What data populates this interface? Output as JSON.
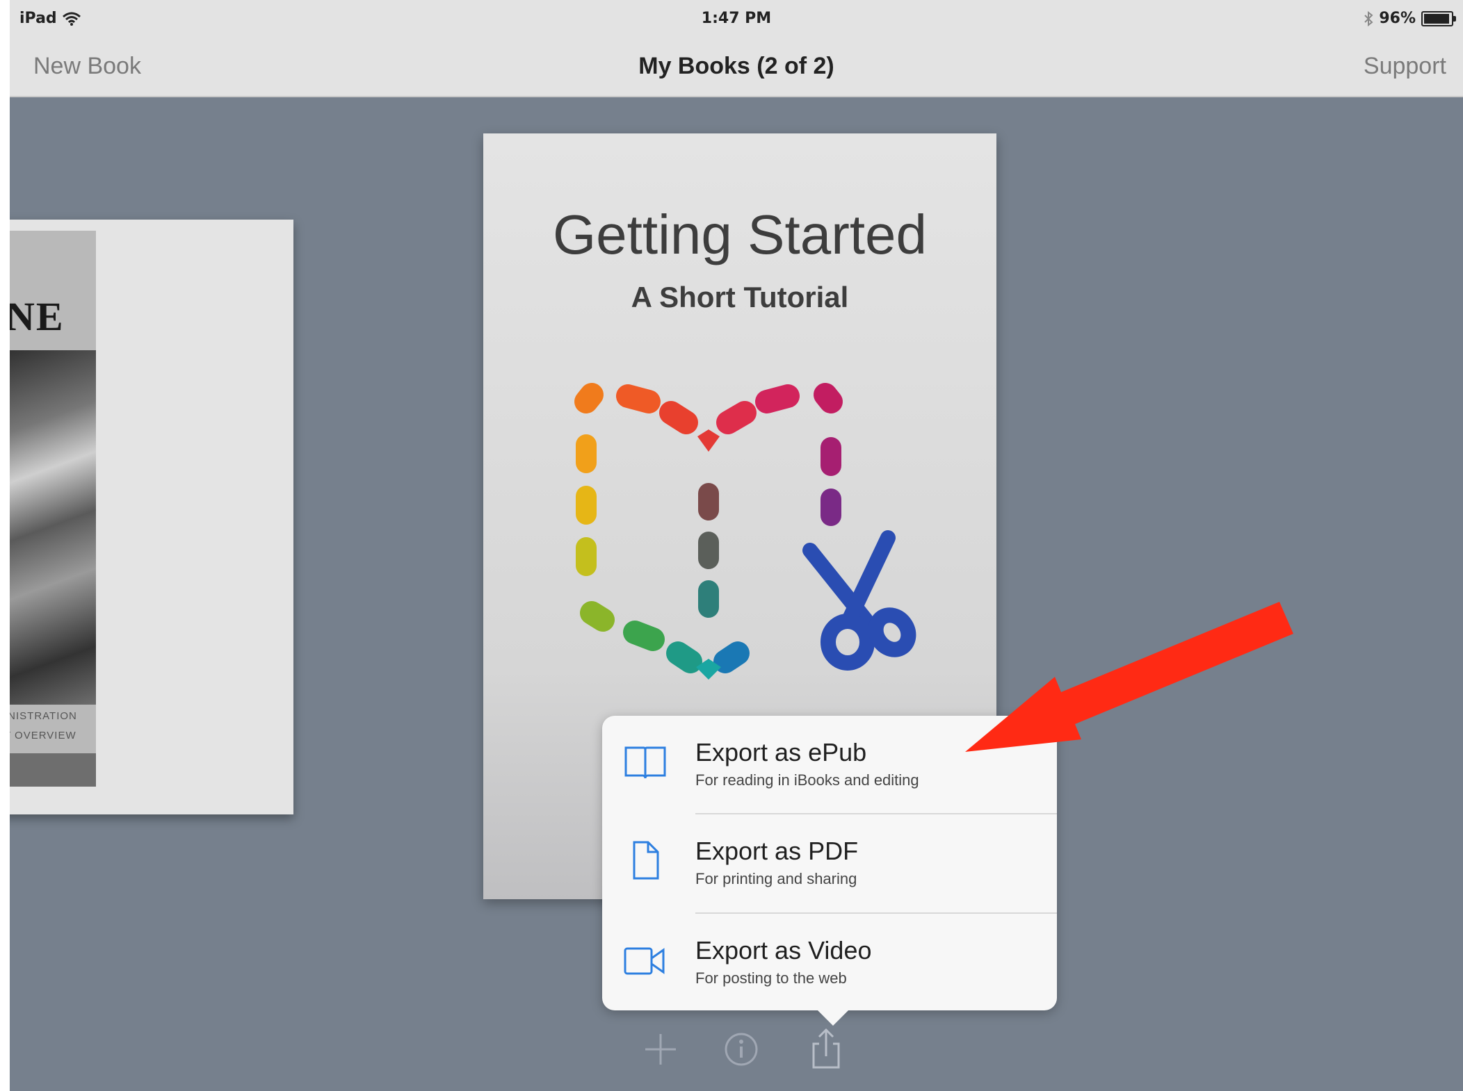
{
  "status_bar": {
    "device": "iPad",
    "time": "1:47 PM",
    "battery_percent": "96%",
    "battery_level": 0.96
  },
  "nav_bar": {
    "left_button": "New Book",
    "title": "My Books (2 of 2)",
    "right_button": "Support"
  },
  "book_left": {
    "title_fragment": "NE",
    "caption_line1": "INISTRATION",
    "caption_line2": "T OVERVIEW"
  },
  "book_center": {
    "title": "Getting Started",
    "subtitle": "A Short Tutorial",
    "logo_icon": "book-creator-logo-icon"
  },
  "export_menu": {
    "items": [
      {
        "title": "Export as ePub",
        "subtitle": "For reading in iBooks and editing",
        "icon": "book-icon"
      },
      {
        "title": "Export as PDF",
        "subtitle": "For printing and sharing",
        "icon": "document-icon"
      },
      {
        "title": "Export as Video",
        "subtitle": "For posting to the web",
        "icon": "video-camera-icon"
      }
    ]
  },
  "toolbar": {
    "buttons": [
      {
        "icon": "plus-icon"
      },
      {
        "icon": "info-icon"
      },
      {
        "icon": "share-icon"
      }
    ]
  },
  "colors": {
    "background": "#76808d",
    "bar": "#e3e3e3",
    "popover": "#f7f7f7",
    "icon_blue": "#2d7fe0",
    "annotation_arrow": "#ff2a14"
  }
}
